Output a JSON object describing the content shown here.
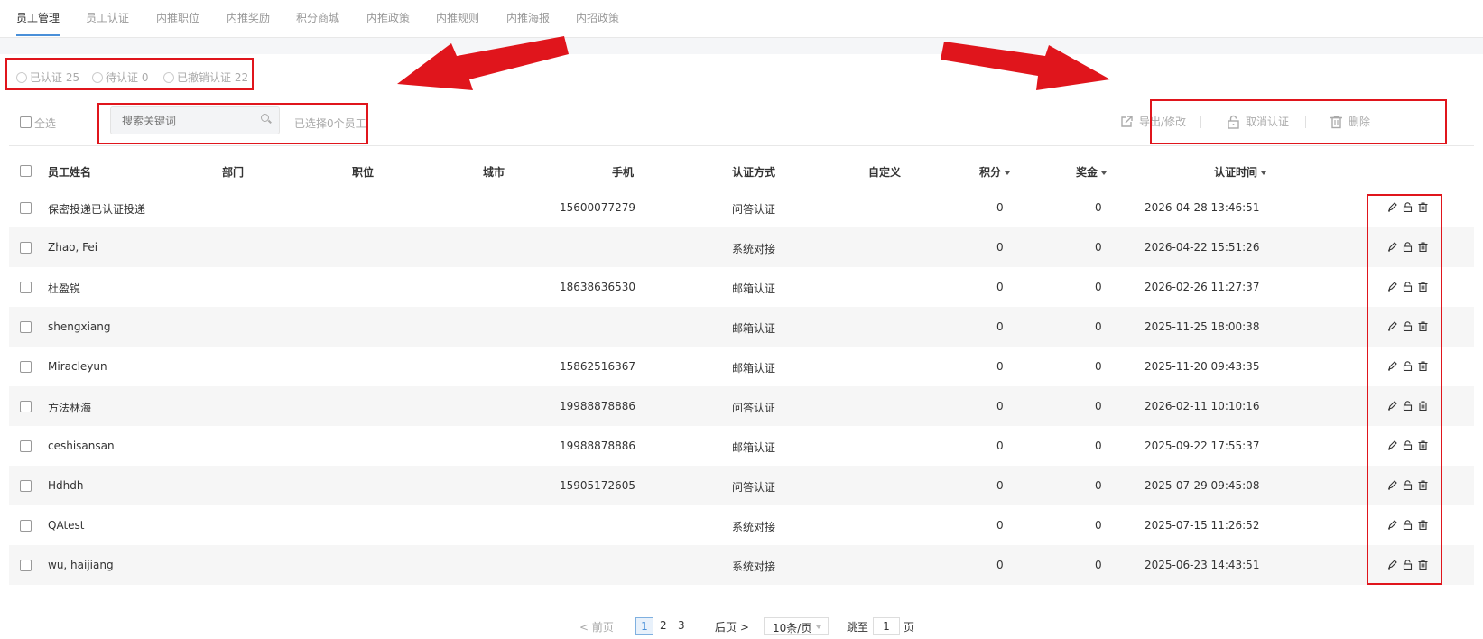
{
  "tabs": [
    {
      "label": "员工管理",
      "active": true
    },
    {
      "label": "员工认证",
      "active": false
    },
    {
      "label": "内推职位",
      "active": false
    },
    {
      "label": "内推奖励",
      "active": false
    },
    {
      "label": "积分商城",
      "active": false
    },
    {
      "label": "内推政策",
      "active": false
    },
    {
      "label": "内推规则",
      "active": false
    },
    {
      "label": "内推海报",
      "active": false
    },
    {
      "label": "内招政策",
      "active": false
    }
  ],
  "filters": [
    {
      "label": "已认证 25"
    },
    {
      "label": "待认证 0"
    },
    {
      "label": "已撤销认证 22"
    }
  ],
  "toolbar": {
    "select_all": "全选",
    "search_placeholder": "搜索关键词",
    "selected_count": "已选择0个员工",
    "export": "导出/修改",
    "unverify": "取消认证",
    "delete": "删除"
  },
  "columns": [
    "员工姓名",
    "部门",
    "职位",
    "城市",
    "手机",
    "认证方式",
    "自定义",
    "积分",
    "奖金",
    "认证时间"
  ],
  "rows": [
    {
      "name": "保密投递已认证投递",
      "dept": "",
      "pos": "",
      "city": "",
      "phone": "15600077279",
      "method": "问答认证",
      "custom": "",
      "points": "0",
      "bonus": "0",
      "time": "2026-04-28 13:46:51"
    },
    {
      "name": "Zhao, Fei",
      "dept": "",
      "pos": "",
      "city": "",
      "phone": "",
      "method": "系统对接",
      "custom": "",
      "points": "0",
      "bonus": "0",
      "time": "2026-04-22 15:51:26"
    },
    {
      "name": "杜盈锐",
      "dept": "",
      "pos": "",
      "city": "",
      "phone": "18638636530",
      "method": "邮箱认证",
      "custom": "",
      "points": "0",
      "bonus": "0",
      "time": "2026-02-26 11:27:37"
    },
    {
      "name": "shengxiang",
      "dept": "",
      "pos": "",
      "city": "",
      "phone": "",
      "method": "邮箱认证",
      "custom": "",
      "points": "0",
      "bonus": "0",
      "time": "2025-11-25 18:00:38"
    },
    {
      "name": "Miracleyun",
      "dept": "",
      "pos": "",
      "city": "",
      "phone": "15862516367",
      "method": "邮箱认证",
      "custom": "",
      "points": "0",
      "bonus": "0",
      "time": "2025-11-20 09:43:35"
    },
    {
      "name": "方法林海",
      "dept": "",
      "pos": "",
      "city": "",
      "phone": "19988878886",
      "method": "问答认证",
      "custom": "",
      "points": "0",
      "bonus": "0",
      "time": "2026-02-11 10:10:16"
    },
    {
      "name": "ceshisansan",
      "dept": "",
      "pos": "",
      "city": "",
      "phone": "19988878886",
      "method": "邮箱认证",
      "custom": "",
      "points": "0",
      "bonus": "0",
      "time": "2025-09-22 17:55:37"
    },
    {
      "name": "Hdhdh",
      "dept": "",
      "pos": "",
      "city": "",
      "phone": "15905172605",
      "method": "问答认证",
      "custom": "",
      "points": "0",
      "bonus": "0",
      "time": "2025-07-29 09:45:08"
    },
    {
      "name": "QAtest",
      "dept": "",
      "pos": "",
      "city": "",
      "phone": "",
      "method": "系统对接",
      "custom": "",
      "points": "0",
      "bonus": "0",
      "time": "2025-07-15 11:26:52"
    },
    {
      "name": "wu, haijiang",
      "dept": "",
      "pos": "",
      "city": "",
      "phone": "",
      "method": "系统对接",
      "custom": "",
      "points": "0",
      "bonus": "0",
      "time": "2025-06-23 14:43:51"
    }
  ],
  "pagination": {
    "prev": "< 前页",
    "pages": [
      "1",
      "2",
      "3"
    ],
    "current": "1",
    "next": "后页 >",
    "page_size": "10条/页",
    "goto_label": "跳至",
    "goto_value": "1",
    "page_suffix": "页"
  },
  "colors": {
    "accent": "#4a90d9",
    "annotation_red": "#e0151c"
  },
  "icons": [
    "search-icon",
    "export-icon",
    "unlock-icon",
    "trash-icon",
    "edit-icon"
  ]
}
